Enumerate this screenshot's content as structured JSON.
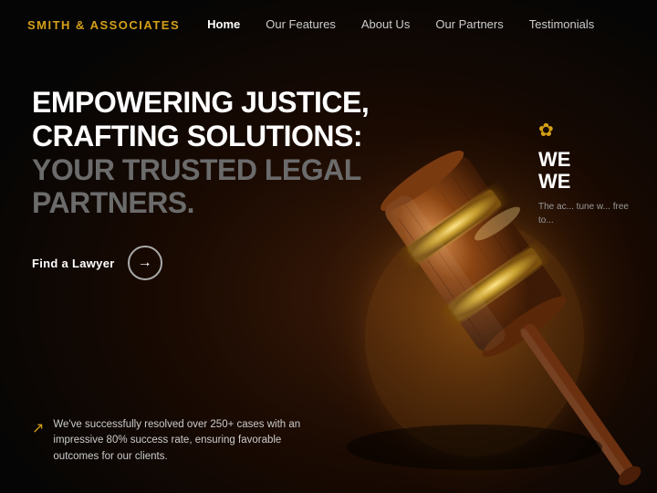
{
  "brand": {
    "logo": "SMITH & ASSOCIATES"
  },
  "nav": {
    "links": [
      {
        "label": "Home",
        "active": true
      },
      {
        "label": "Our Features",
        "active": false
      },
      {
        "label": "About Us",
        "active": false
      },
      {
        "label": "Our Partners",
        "active": false
      },
      {
        "label": "Testimonials",
        "active": false
      }
    ]
  },
  "hero": {
    "title_line1": "EMPOWERING JUSTICE,",
    "title_line2": "CRAFTING SOLUTIONS:",
    "title_line3": "YOUR TRUSTED LEGAL",
    "title_line4": "PARTNERS.",
    "cta_label": "Find a Lawyer",
    "cta_arrow": "→"
  },
  "stats": {
    "arrow": "↗",
    "text": "We've successfully resolved over 250+ cases with an impressive 80% success rate, ensuring favorable outcomes for our clients."
  },
  "right_panel": {
    "icon": "✿",
    "title_line1": "WE",
    "title_line2": "WE",
    "text": "The ac... tune w... free to..."
  },
  "colors": {
    "gold": "#d4a017",
    "dark": "#0a0a0a"
  }
}
